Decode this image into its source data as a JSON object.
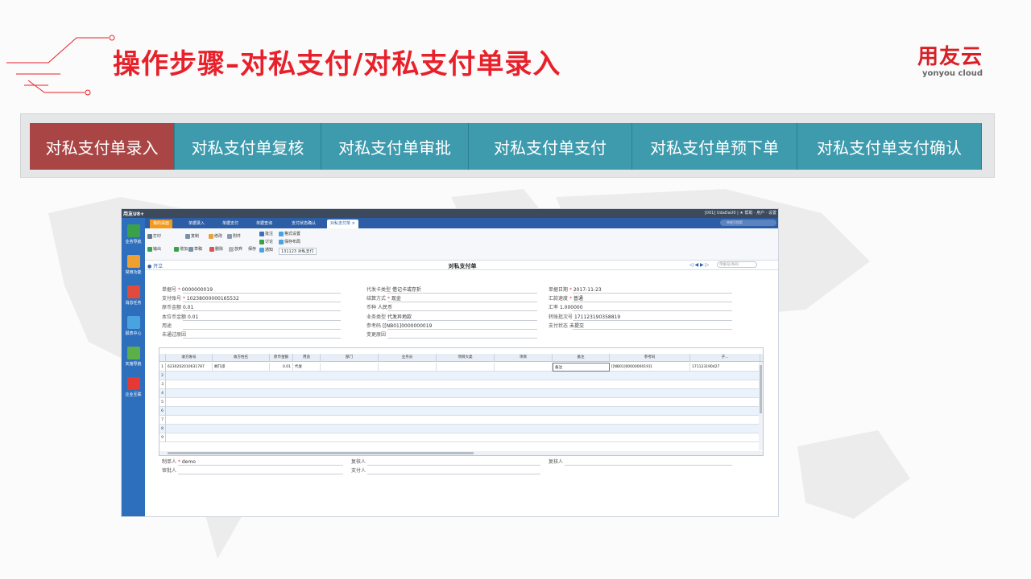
{
  "header": {
    "title": "操作步骤–对私支付/对私支付单录入",
    "logo_zh": "用友云",
    "logo_en": "yonyou cloud"
  },
  "colors": {
    "title": "#e8202a",
    "step_active": "#a94545",
    "step": "#3d9bad"
  },
  "steps": [
    {
      "label": "对私支付单录入",
      "active": true
    },
    {
      "label": "对私支付单复核",
      "active": false
    },
    {
      "label": "对私支付单审批",
      "active": false
    },
    {
      "label": "对私支付单支付",
      "active": false
    },
    {
      "label": "对私支付单预下单",
      "active": false
    },
    {
      "label": "对私支付单支付确认",
      "active": false
    }
  ],
  "app": {
    "name": "用友U8+",
    "titlebar_right": "[001] UdaDaU0 | ★ 帮助 · 用户 · 设置",
    "left_nav": [
      "业务导航",
      "常用功能",
      "消息任务",
      "报表中心",
      "实施导航",
      "企业互联"
    ],
    "tabs": [
      "我的桌面",
      "单据录入",
      "单据支付",
      "单据查询",
      "支付状态确认",
      "对私支付单 ×"
    ],
    "search_placeholder": "单据号搜索",
    "toolbar": {
      "print": "打印",
      "output": "输出",
      "add": "增加",
      "copy": "复制",
      "modify": "修改",
      "attach": "附件",
      "draft": "草稿",
      "delete": "删除",
      "discard": "放弃",
      "save": "保存",
      "approve": "批注",
      "discuss": "讨论",
      "notify": "通知",
      "format_setting": "格式设置",
      "save_layout": "保存布局",
      "template": "131123 对私支付"
    },
    "form_title": "对私支付单",
    "open_label": "● 开立",
    "nav_search": "单据号/条码",
    "fields": {
      "bill_no_label": "单据号",
      "bill_no": "0000000019",
      "pay_account_label": "支付账号",
      "pay_account": "10238000000165532",
      "orig_amount_label": "原币金额",
      "orig_amount": "0.01",
      "local_amount_label": "本位币金额",
      "local_amount": "0.01",
      "purpose_label": "用途",
      "purpose": "",
      "reject_reason_label": "未通过原因",
      "card_type_label": "代发卡类型",
      "card_type": "借记卡或存折",
      "settle_label": "结算方式",
      "settle": "现金",
      "currency_label": "币种",
      "currency": "人民币",
      "biz_type_label": "业务类型",
      "biz_type": "代发异地款",
      "ref_code_label": "参考码",
      "ref_code": "[[NB01]0000000019",
      "change_reason_label": "变更原因",
      "date_label": "单据日期",
      "date": "2017-11-23",
      "speed_label": "汇款速度",
      "speed": "普通",
      "rate_label": "汇率",
      "rate": "1.000000",
      "serial_label": "转账批次号",
      "serial": "171123190358819",
      "pay_status_label": "支付状态",
      "pay_status": "未提交"
    },
    "grid": {
      "columns": [
        "收方账号",
        "收方姓名",
        "原币金额",
        "用途",
        "部门",
        "业务员",
        "项目大类",
        "项目",
        "备注",
        "参考码",
        "子..."
      ],
      "rows": [
        [
          "1",
          "6230202010631787",
          "顾乃琼",
          "0.01",
          "代发",
          "",
          "",
          "",
          "",
          "备注",
          "[[NB01]0000000019]1",
          "171123190427"
        ],
        [
          "2"
        ],
        [
          "3"
        ],
        [
          "4"
        ],
        [
          "5"
        ],
        [
          "6"
        ],
        [
          "7"
        ],
        [
          "8"
        ],
        [
          "9"
        ]
      ]
    },
    "footer": {
      "maker_label": "制单人",
      "maker": "demo",
      "approver_label": "审批人",
      "reviewer_label": "复核人",
      "payer_label": "支付人",
      "checker_label": "复核人"
    }
  }
}
